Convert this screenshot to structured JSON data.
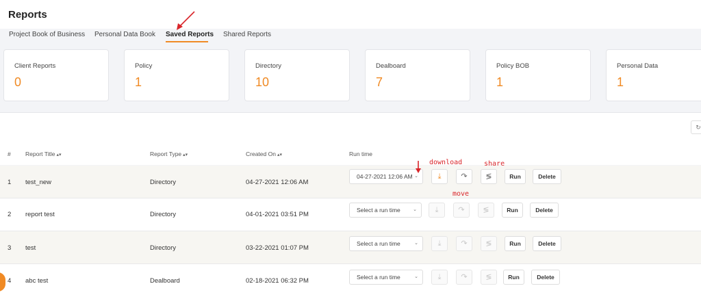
{
  "header": {
    "title": "Reports"
  },
  "tabs": [
    {
      "label": "Project Book of Business"
    },
    {
      "label": "Personal Data Book"
    },
    {
      "label": "Saved Reports"
    },
    {
      "label": "Shared Reports"
    }
  ],
  "cards": [
    {
      "label": "Client Reports",
      "value": "0"
    },
    {
      "label": "Policy",
      "value": "1"
    },
    {
      "label": "Directory",
      "value": "10"
    },
    {
      "label": "Dealboard",
      "value": "7"
    },
    {
      "label": "Policy BOB",
      "value": "1"
    },
    {
      "label": "Personal Data",
      "value": "1"
    }
  ],
  "table": {
    "columns": {
      "index": "#",
      "title": "Report Title",
      "type": "Report Type",
      "created": "Created On",
      "runtime": "Run time"
    },
    "rows": [
      {
        "index": "1",
        "title": "test_new",
        "type": "Directory",
        "created": "04-27-2021 12:06 AM",
        "runtime": "04-27-2021 12:06 AM"
      },
      {
        "index": "2",
        "title": "report test",
        "type": "Directory",
        "created": "04-01-2021 03:51 PM",
        "runtime": "Select a run time"
      },
      {
        "index": "3",
        "title": "test",
        "type": "Directory",
        "created": "03-22-2021 01:07 PM",
        "runtime": "Select a run time"
      },
      {
        "index": "4",
        "title": "abc test",
        "type": "Dealboard",
        "created": "02-18-2021 06:32 PM",
        "runtime": "Select a run time"
      }
    ],
    "run_label": "Run",
    "delete_label": "Delete"
  },
  "annotations": {
    "download": "download",
    "share": "share",
    "move": "move"
  },
  "colors": {
    "accent": "#f08a24",
    "annotation": "#d9252a"
  }
}
